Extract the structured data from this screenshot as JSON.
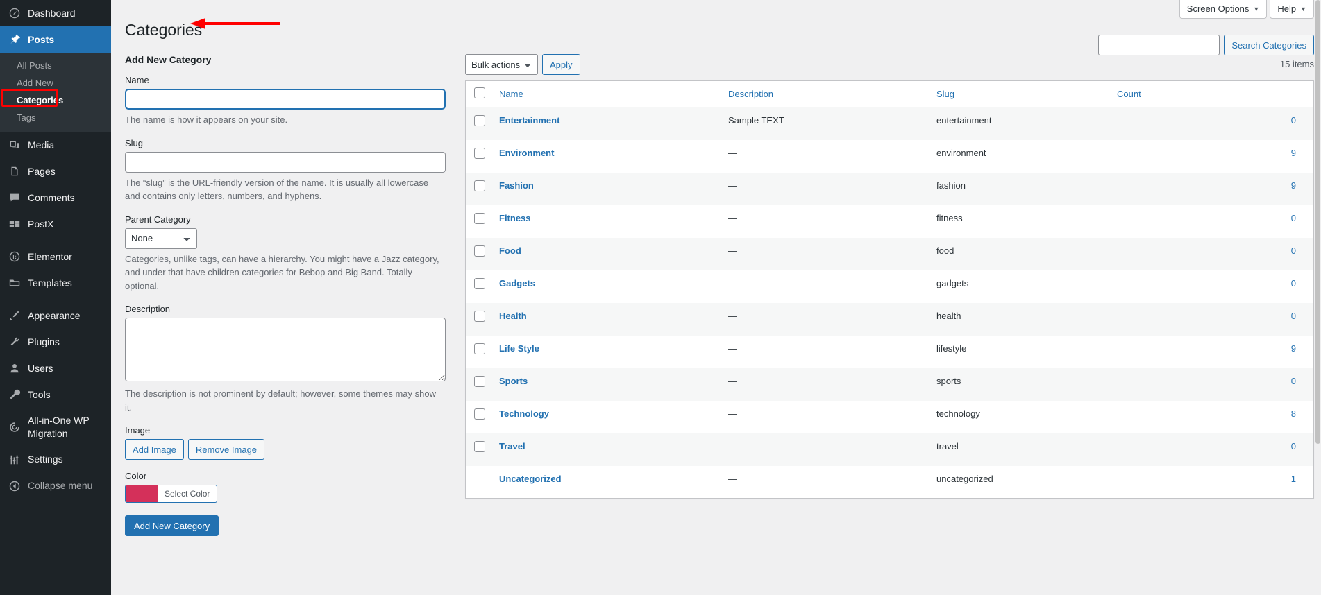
{
  "sidebar": {
    "items": [
      {
        "label": "Dashboard",
        "icon": "dashboard-icon",
        "state": "normal"
      },
      {
        "label": "Posts",
        "icon": "pin-icon",
        "state": "active"
      },
      {
        "label": "Media",
        "icon": "media-icon",
        "state": "normal"
      },
      {
        "label": "Pages",
        "icon": "pages-icon",
        "state": "normal"
      },
      {
        "label": "Comments",
        "icon": "comments-icon",
        "state": "normal"
      },
      {
        "label": "PostX",
        "icon": "postx-icon",
        "state": "normal"
      },
      {
        "label": "Elementor",
        "icon": "elementor-icon",
        "state": "normal"
      },
      {
        "label": "Templates",
        "icon": "templates-icon",
        "state": "normal"
      },
      {
        "label": "Appearance",
        "icon": "appearance-icon",
        "state": "normal"
      },
      {
        "label": "Plugins",
        "icon": "plugins-icon",
        "state": "normal"
      },
      {
        "label": "Users",
        "icon": "users-icon",
        "state": "normal"
      },
      {
        "label": "Tools",
        "icon": "tools-icon",
        "state": "normal"
      },
      {
        "label": "All-in-One WP Migration",
        "icon": "migration-icon",
        "state": "normal"
      },
      {
        "label": "Settings",
        "icon": "settings-icon",
        "state": "normal"
      },
      {
        "label": "Collapse menu",
        "icon": "collapse-icon",
        "state": "dim"
      }
    ],
    "submenu": [
      {
        "label": "All Posts",
        "current": false
      },
      {
        "label": "Add New",
        "current": false
      },
      {
        "label": "Categories",
        "current": true
      },
      {
        "label": "Tags",
        "current": false
      }
    ],
    "highlight_color": "#ff0000"
  },
  "screen_meta": {
    "screen_options": "Screen Options",
    "help": "Help",
    "caret": "▼"
  },
  "header": {
    "title": "Categories",
    "annotation_color": "#ff0000"
  },
  "search": {
    "value": "",
    "placeholder": "",
    "button_label": "Search Categories"
  },
  "form": {
    "heading": "Add New Category",
    "name": {
      "label": "Name",
      "value": "",
      "help": "The name is how it appears on your site."
    },
    "slug": {
      "label": "Slug",
      "value": "",
      "help": "The “slug” is the URL-friendly version of the name. It is usually all lowercase and contains only letters, numbers, and hyphens."
    },
    "parent": {
      "label": "Parent Category",
      "selected": "None",
      "options": [
        "None"
      ],
      "help": "Categories, unlike tags, can have a hierarchy. You might have a Jazz category, and under that have children categories for Bebop and Big Band. Totally optional."
    },
    "description": {
      "label": "Description",
      "value": "",
      "help": "The description is not prominent by default; however, some themes may show it."
    },
    "image": {
      "label": "Image",
      "add_label": "Add Image",
      "remove_label": "Remove Image"
    },
    "color": {
      "label": "Color",
      "swatch_hex": "#d4305a",
      "select_label": "Select Color"
    },
    "submit_label": "Add New Category"
  },
  "tablenav": {
    "bulk_actions_selected": "Bulk actions",
    "bulk_actions_options": [
      "Bulk actions"
    ],
    "apply_label": "Apply",
    "items_count": "15 items"
  },
  "table": {
    "columns": {
      "name": "Name",
      "description": "Description",
      "slug": "Slug",
      "count": "Count"
    },
    "rows": [
      {
        "name": "Entertainment",
        "description": "Sample TEXT",
        "slug": "entertainment",
        "count": "0",
        "selectable": true
      },
      {
        "name": "Environment",
        "description": "—",
        "slug": "environment",
        "count": "9",
        "selectable": true
      },
      {
        "name": "Fashion",
        "description": "—",
        "slug": "fashion",
        "count": "9",
        "selectable": true
      },
      {
        "name": "Fitness",
        "description": "—",
        "slug": "fitness",
        "count": "0",
        "selectable": true
      },
      {
        "name": "Food",
        "description": "—",
        "slug": "food",
        "count": "0",
        "selectable": true
      },
      {
        "name": "Gadgets",
        "description": "—",
        "slug": "gadgets",
        "count": "0",
        "selectable": true
      },
      {
        "name": "Health",
        "description": "—",
        "slug": "health",
        "count": "0",
        "selectable": true
      },
      {
        "name": "Life Style",
        "description": "—",
        "slug": "lifestyle",
        "count": "9",
        "selectable": true
      },
      {
        "name": "Sports",
        "description": "—",
        "slug": "sports",
        "count": "0",
        "selectable": true
      },
      {
        "name": "Technology",
        "description": "—",
        "slug": "technology",
        "count": "8",
        "selectable": true
      },
      {
        "name": "Travel",
        "description": "—",
        "slug": "travel",
        "count": "0",
        "selectable": true
      },
      {
        "name": "Uncategorized",
        "description": "—",
        "slug": "uncategorized",
        "count": "1",
        "selectable": false
      }
    ]
  }
}
